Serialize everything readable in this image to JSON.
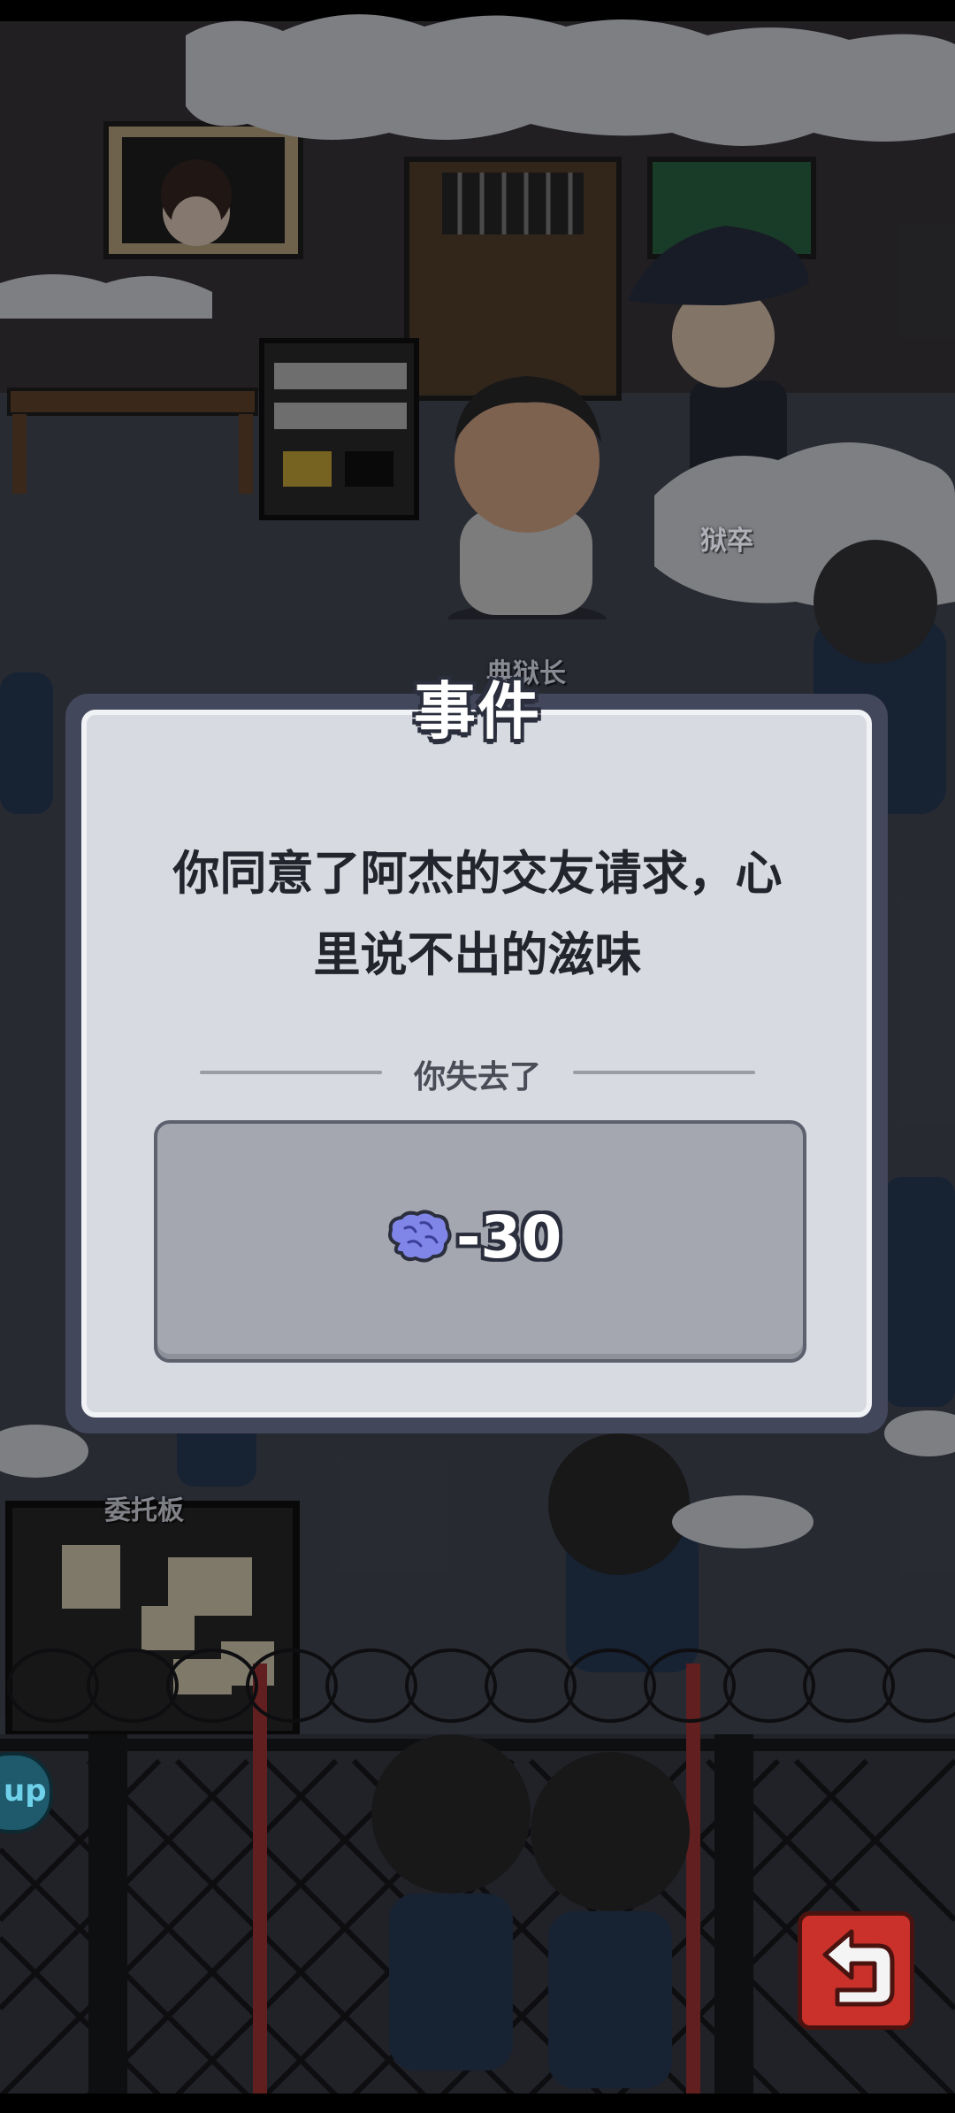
{
  "scene": {
    "labels": {
      "guard": "狱卒",
      "warden": "典狱长",
      "board": "委托板"
    },
    "side_button_text": "up"
  },
  "dialog": {
    "title": "事件",
    "message_line1": "你同意了阿杰的交友请求，心",
    "message_line2": "里说不出的滋味",
    "divider_label": "你失去了",
    "loss_value": "-30",
    "loss_icon": "brain-icon"
  },
  "controls": {
    "back_icon": "return-arrow-icon"
  },
  "colors": {
    "dialog_frame": "#42475b",
    "dialog_panel": "#d8dae1",
    "reward_box": "#a5a7b0",
    "brain": "#7f86e8",
    "back_button": "#c9312a"
  }
}
